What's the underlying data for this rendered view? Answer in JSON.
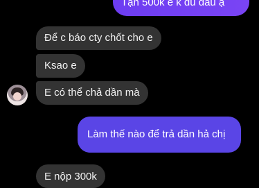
{
  "messages": [
    {
      "sender": "me",
      "text": "Tận 500k e k đủ đâu ạ"
    },
    {
      "sender": "them",
      "text": "Để c báo cty chốt cho e"
    },
    {
      "sender": "them",
      "text": "Ksao e"
    },
    {
      "sender": "them",
      "text": "E có thể chả dần mà"
    },
    {
      "sender": "me",
      "text": "Làm thế nào để trả dần hả chị"
    },
    {
      "sender": "them",
      "text": "E nộp 300k"
    }
  ],
  "colors": {
    "background": "#000000",
    "incoming_bubble": "#333333",
    "outgoing_bubble_top": "#7a44f4",
    "outgoing_bubble_bottom": "#5a45e6"
  },
  "avatar": {
    "icon": "profile-avatar-icon"
  }
}
